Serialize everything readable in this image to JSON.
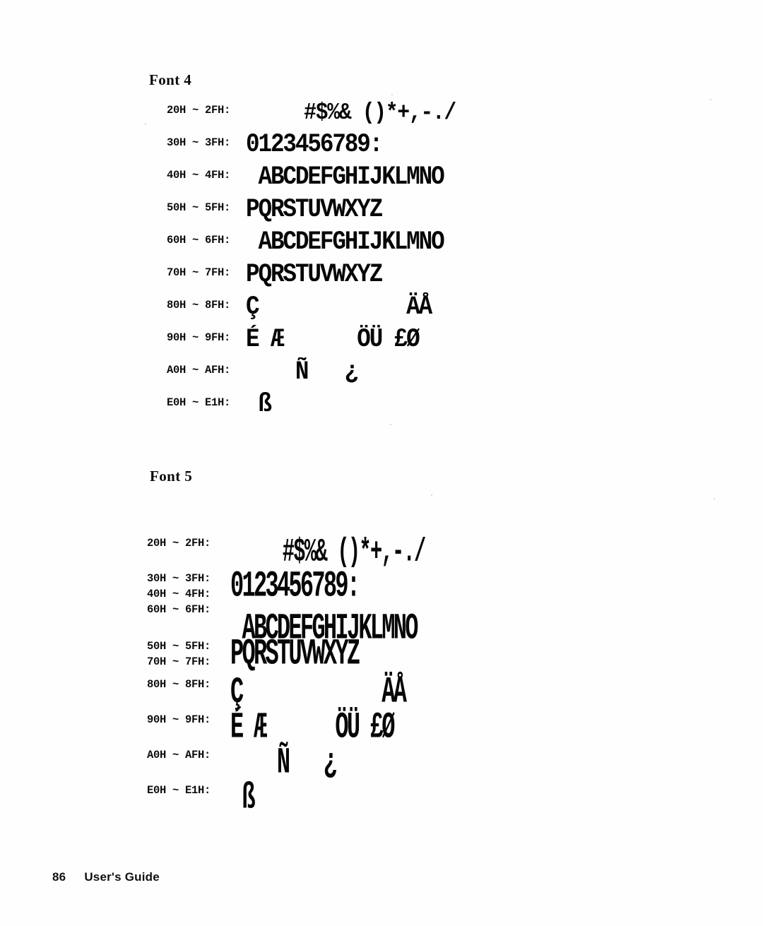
{
  "page": {
    "number": "86",
    "document_title": "User's Guide"
  },
  "sections": [
    {
      "heading": "Font 4",
      "rows": [
        {
          "labels": [
            "20H ~ 2FH:"
          ],
          "sample": "   #$%& ()*+,-./"
        },
        {
          "labels": [
            "30H ~ 3FH:"
          ],
          "sample": "0123456789:"
        },
        {
          "labels": [
            "40H ~ 4FH:"
          ],
          "sample": " ABCDEFGHIJKLMNO"
        },
        {
          "labels": [
            "50H ~ 5FH:"
          ],
          "sample": "PQRSTUVWXYZ"
        },
        {
          "labels": [
            "60H ~ 6FH:"
          ],
          "sample": " ABCDEFGHIJKLMNO"
        },
        {
          "labels": [
            "70H ~ 7FH:"
          ],
          "sample": "PQRSTUVWXYZ"
        },
        {
          "labels": [
            "80H ~ 8FH:"
          ],
          "sample": "Ç            ÄÅ"
        },
        {
          "labels": [
            "90H ~ 9FH:"
          ],
          "sample": "É Æ      ÖÜ £Ø"
        },
        {
          "labels": [
            "A0H ~ AFH:"
          ],
          "sample": "    Ñ   ¿"
        },
        {
          "labels": [
            "E0H ~ E1H:"
          ],
          "sample": " ß"
        }
      ]
    },
    {
      "heading": "Font 5",
      "rows": [
        {
          "labels": [
            "20H ~ 2FH:"
          ],
          "sample": "   #$%& ()*+,-./"
        },
        {
          "labels": [
            "30H ~ 3FH:",
            "40H ~ 4FH:",
            "60H ~ 6FH:"
          ],
          "sample": "0123456789:\n ABCDEFGHIJKLMNO"
        },
        {
          "labels": [
            "50H ~ 5FH:",
            "70H ~ 7FH:"
          ],
          "sample": "PQRSTUVWXYZ"
        },
        {
          "labels": [
            "80H ~ 8FH:"
          ],
          "sample": "Ç            ÄÅ"
        },
        {
          "labels": [
            "90H ~ 9FH:"
          ],
          "sample": "É Æ      ÖÜ £Ø"
        },
        {
          "labels": [
            "A0H ~ AFH:"
          ],
          "sample": "    Ñ   ¿"
        },
        {
          "labels": [
            "E0H ~ E1H:"
          ],
          "sample": " ß"
        }
      ]
    }
  ]
}
